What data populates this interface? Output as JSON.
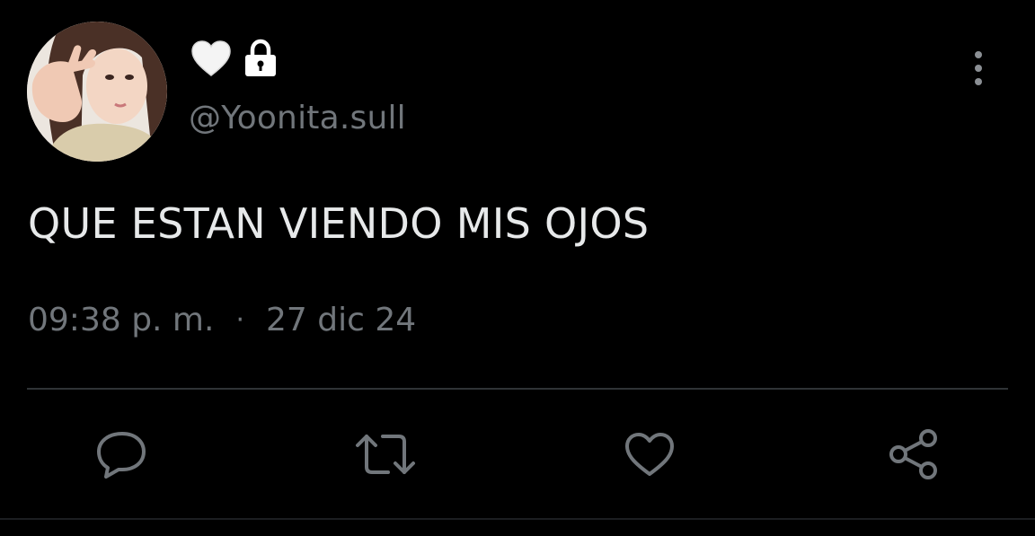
{
  "author": {
    "display_name_icons": [
      "white-heart-icon",
      "lock-icon"
    ],
    "handle": "@Yoonita.sull"
  },
  "tweet": {
    "text": "QUE ESTAN VIENDO MIS OJOS",
    "time": "09:38 p. m.",
    "separator": "·",
    "date": "27 dic 24"
  },
  "actions": [
    "reply-icon",
    "retweet-icon",
    "like-icon",
    "share-icon"
  ],
  "colors": {
    "background": "#000000",
    "text": "#e7e9ea",
    "secondary": "#71767b",
    "divider": "#2f3336"
  }
}
